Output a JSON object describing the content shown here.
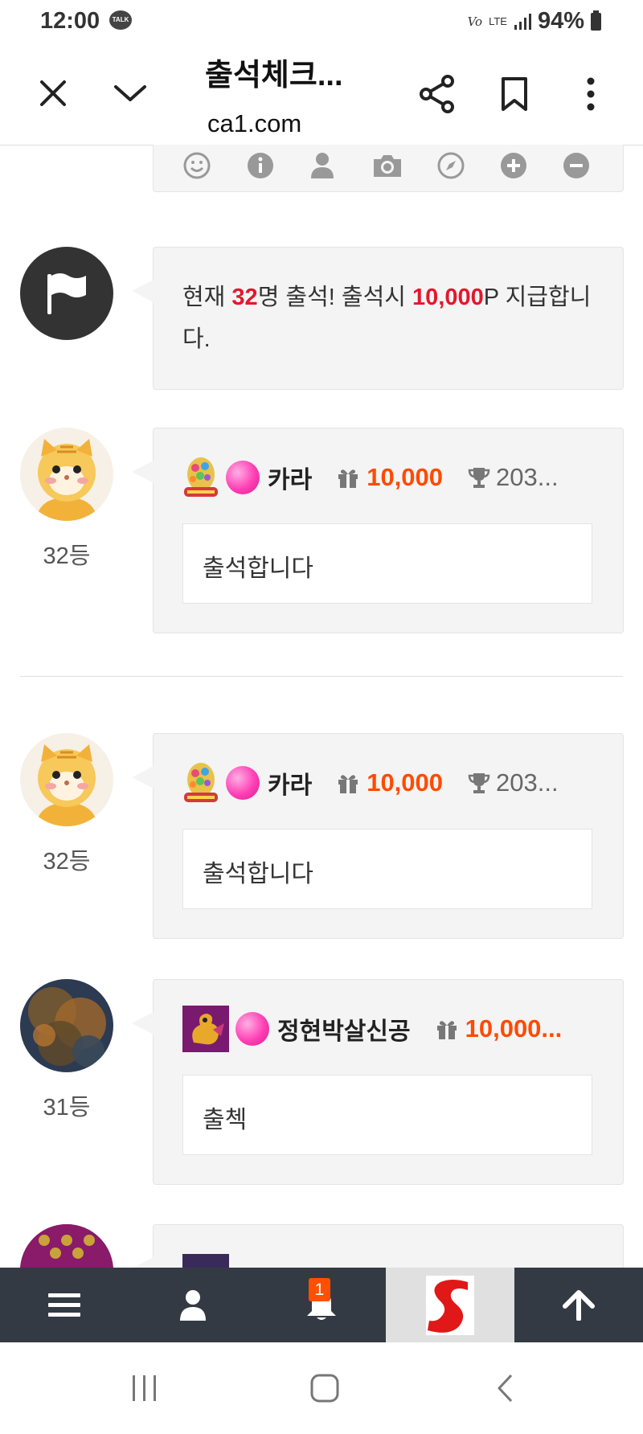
{
  "status_bar": {
    "time": "12:00",
    "talk_label": "TALK",
    "volte": "Vo",
    "network": "LTE",
    "battery": "94%"
  },
  "browser": {
    "title": "출석체크...",
    "url": "ca1.com"
  },
  "notice": {
    "text_prefix": "현재 ",
    "count": "32",
    "text_mid": "명 출석! 출석시 ",
    "points": "10,000",
    "text_suffix": "P 지급합니다."
  },
  "posts": [
    {
      "rank": "32등",
      "nickname": "카라",
      "points": "10,000",
      "score": "203...",
      "message": "출석합니다"
    },
    {
      "rank": "32등",
      "nickname": "카라",
      "points": "10,000",
      "score": "203...",
      "message": "출석합니다"
    },
    {
      "rank": "31등",
      "nickname": "정현박살신공",
      "points": "10,000...",
      "message": "출첵"
    }
  ],
  "bottom_nav": {
    "notification_count": "1"
  },
  "colors": {
    "accent_red": "#e4172d",
    "points_orange": "#ff4a00",
    "nav_bg": "#343a44"
  }
}
